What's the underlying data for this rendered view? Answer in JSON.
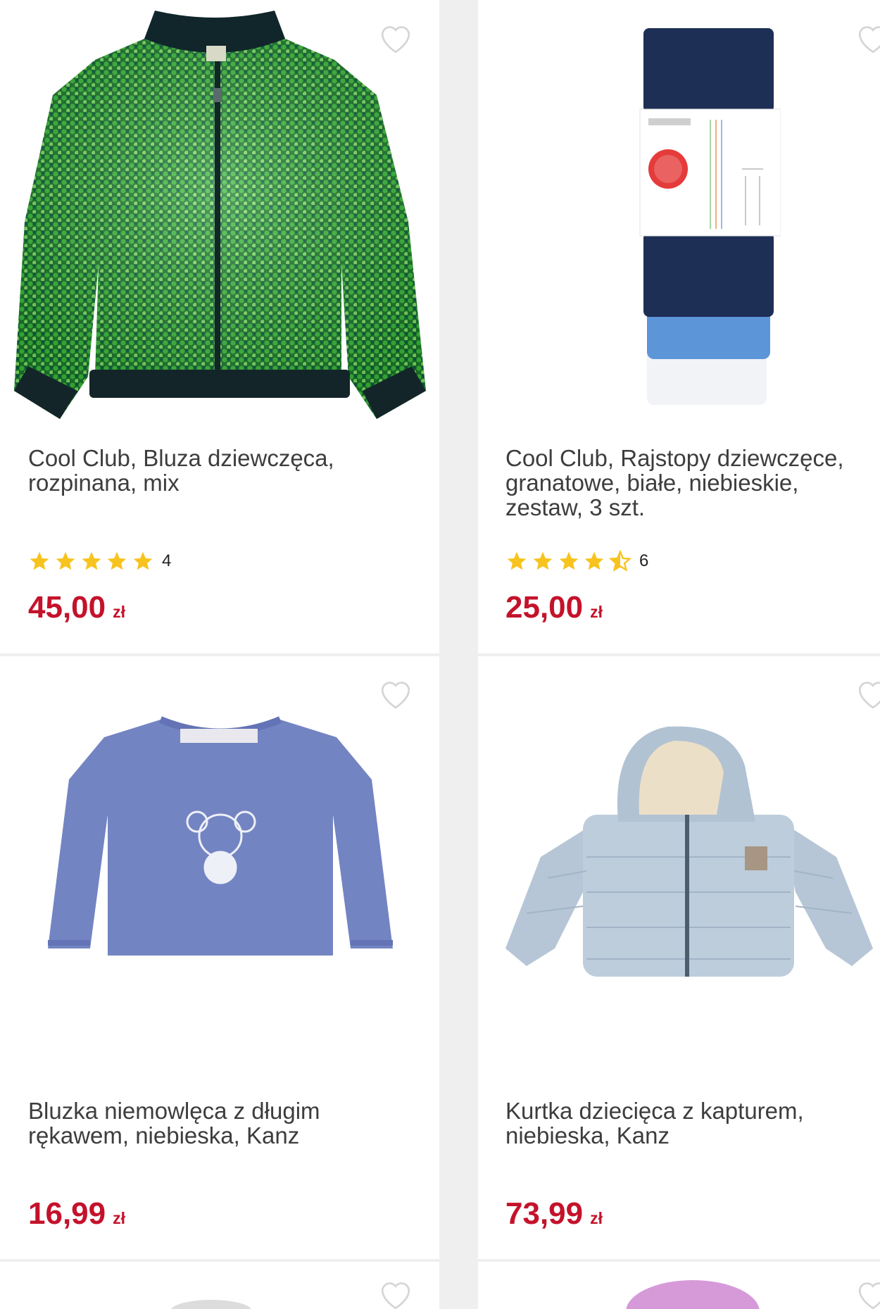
{
  "currency": "zł",
  "icons": {
    "favorite": "heart-outline-icon",
    "star": "star-icon"
  },
  "colors": {
    "price": "#c4122b",
    "star": "#f7c31e",
    "page_bg": "#efefef",
    "card_bg": "#ffffff"
  },
  "products": [
    {
      "name": "Cool Club, Bluza dziewczęca,\nrozpinana, mix",
      "rating": 5,
      "rating_count": "4",
      "price": "45,00",
      "image": "green-sequin-bomber-jacket"
    },
    {
      "name": "Cool Club, Rajstopy dziewczęce,\ngranatowe, białe, niebieskie,\nzestaw, 3 szt.",
      "rating": 4.5,
      "rating_count": "6",
      "price": "25,00",
      "image": "tights-pack-three-pairs"
    },
    {
      "name": "Bluzka niemowlęca z długim\nrękawem, niebieska, Kanz",
      "rating": null,
      "rating_count": null,
      "price": "16,99",
      "image": "blue-baby-long-sleeve-top"
    },
    {
      "name": "Kurtka dziecięca z kapturem,\nniebieska, Kanz",
      "rating": null,
      "rating_count": null,
      "price": "73,99",
      "image": "light-blue-hooded-puffer-jacket"
    }
  ]
}
